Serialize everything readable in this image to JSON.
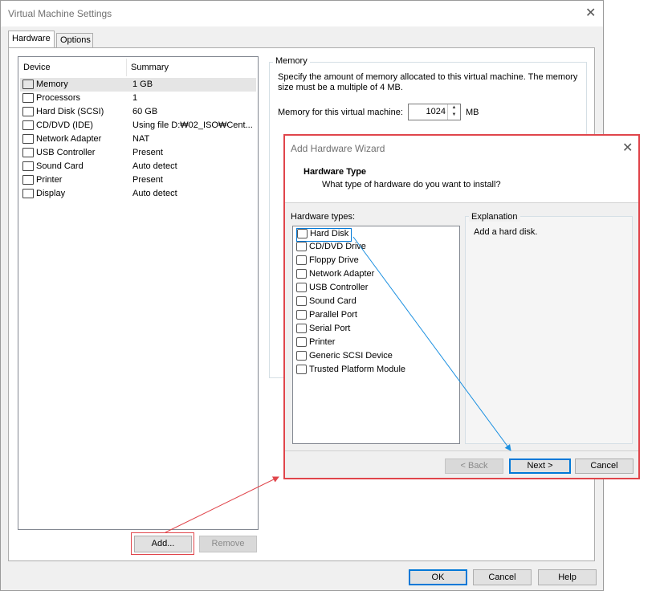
{
  "window": {
    "title": "Virtual Machine Settings",
    "tabs": [
      "Hardware",
      "Options"
    ]
  },
  "device_list": {
    "col_device": "Device",
    "col_summary": "Summary",
    "rows": [
      {
        "name": "Memory",
        "summary": "1 GB",
        "icon": "memory-icon"
      },
      {
        "name": "Processors",
        "summary": "1",
        "icon": "processor-icon"
      },
      {
        "name": "Hard Disk (SCSI)",
        "summary": "60 GB",
        "icon": "hard-disk-icon"
      },
      {
        "name": "CD/DVD (IDE)",
        "summary": "Using file D:₩02_ISO₩Cent...",
        "icon": "cd-dvd-icon"
      },
      {
        "name": "Network Adapter",
        "summary": "NAT",
        "icon": "network-icon"
      },
      {
        "name": "USB Controller",
        "summary": "Present",
        "icon": "usb-icon"
      },
      {
        "name": "Sound Card",
        "summary": "Auto detect",
        "icon": "speaker-icon"
      },
      {
        "name": "Printer",
        "summary": "Present",
        "icon": "printer-icon"
      },
      {
        "name": "Display",
        "summary": "Auto detect",
        "icon": "display-icon"
      }
    ]
  },
  "buttons": {
    "add": "Add...",
    "remove": "Remove",
    "ok": "OK",
    "cancel": "Cancel",
    "help": "Help"
  },
  "memory": {
    "group_label": "Memory",
    "description": "Specify the amount of memory allocated to this virtual machine. The memory size must be a multiple of 4 MB.",
    "field_label": "Memory for this virtual machine:",
    "value": "1024",
    "unit": "MB"
  },
  "wizard": {
    "title": "Add Hardware Wizard",
    "header_title": "Hardware Type",
    "header_subtitle": "What type of hardware do you want to install?",
    "list_label": "Hardware types:",
    "types": [
      {
        "label": "Hard Disk",
        "icon": "hard-disk-icon"
      },
      {
        "label": "CD/DVD Drive",
        "icon": "cd-dvd-icon"
      },
      {
        "label": "Floppy Drive",
        "icon": "floppy-icon"
      },
      {
        "label": "Network Adapter",
        "icon": "network-icon"
      },
      {
        "label": "USB Controller",
        "icon": "usb-icon"
      },
      {
        "label": "Sound Card",
        "icon": "speaker-icon"
      },
      {
        "label": "Parallel Port",
        "icon": "parallel-port-icon"
      },
      {
        "label": "Serial Port",
        "icon": "serial-port-icon"
      },
      {
        "label": "Printer",
        "icon": "printer-icon"
      },
      {
        "label": "Generic SCSI Device",
        "icon": "scsi-icon"
      },
      {
        "label": "Trusted Platform Module",
        "icon": "tpm-icon"
      }
    ],
    "explanation_label": "Explanation",
    "explanation_text": "Add a hard disk.",
    "back": "< Back",
    "next": "Next >",
    "cancel": "Cancel"
  },
  "colors": {
    "annotation_red": "#e0454b",
    "annotation_blue": "#1a8fe0",
    "selection": "#0078d7"
  }
}
